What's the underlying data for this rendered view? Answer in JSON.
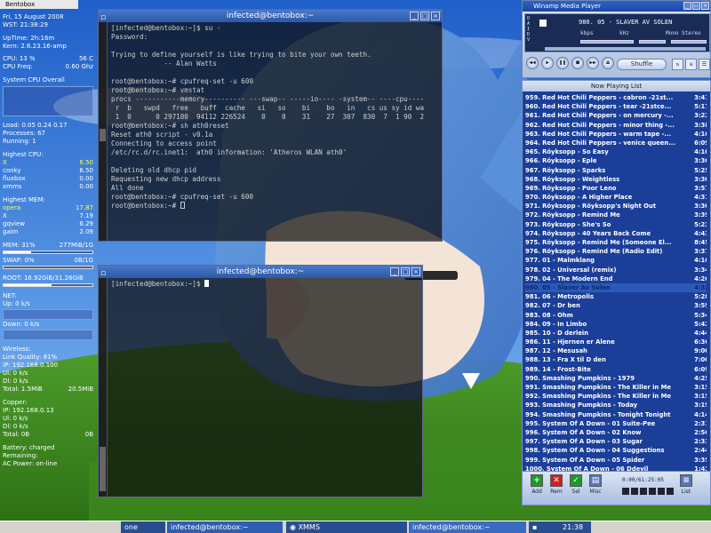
{
  "taskbar": {
    "desktop": "one",
    "task1": "infected@bentobox:~",
    "task2": "XMMS",
    "task3": "infected@bentobox:~",
    "clock": "21:38"
  },
  "conky": {
    "tab": "Bentobox",
    "date": "Fri, 15 August 2008",
    "wst": "WST: 21:38:29",
    "uptime": "UpTime: 2h:16m",
    "kern": "Kern: 2.6.23.16-amp",
    "cpu": "CPU: 13 %",
    "cpu_temp": "56 C",
    "cpu_freq_label": "CPU Freq:",
    "cpu_freq": "0.60 Ghz",
    "sys_cpu": "System CPU Overall",
    "load": "Load: 0.05 0.24 0.17",
    "processes": "Processes: 67",
    "running": "Running: 1",
    "highest_cpu": "Highest CPU:",
    "cpu_procs": [
      {
        "name": "X",
        "val": "6.50"
      },
      {
        "name": "conky",
        "val": "6.50"
      },
      {
        "name": "fluxbox",
        "val": "0.00"
      },
      {
        "name": "xmms",
        "val": "0.00"
      }
    ],
    "highest_mem": "Highest MEM:",
    "mem_procs": [
      {
        "name": "opera",
        "val": "17.87"
      },
      {
        "name": "X",
        "val": "7.19"
      },
      {
        "name": "gqview",
        "val": "6.29"
      },
      {
        "name": "gaim",
        "val": "2.09"
      }
    ],
    "mem": "MEM: 31%",
    "mem_val": "277MiB/1G",
    "swap": "SWAP: 0%",
    "swap_val": "0B/1G",
    "root": "ROOT: 16.92GiB/31.26GiB",
    "net": "NET:",
    "up": "Up: 0 k/s",
    "down": "Down: 0 k/s",
    "wireless": "Wireless:",
    "link_quality": "Link Quality: 81%",
    "ip1": "IP: 192.168.0.100",
    "ul1": "Ul: 0 k/s",
    "dl1": "Dl: 0 k/s",
    "total1": "Total: 1.5MiB",
    "total1b": "20.5MiB",
    "copper": "Copper:",
    "ip2": "IP: 192.168.0.13",
    "ul2": "Ul: 0 k/s",
    "dl2": "Dl: 0 k/s",
    "total2": "Total: 0B",
    "total2b": "0B",
    "battery": "Battery: charged",
    "remaining": "Remaining:",
    "ac": "AC Power: on-line"
  },
  "term1": {
    "title": "infected@bentobox:~",
    "lines": [
      "[infected@bentobox:~]$ su -",
      "Password:",
      "",
      "Trying to define yourself is like trying to bite your own teeth.",
      "             -- Alan Watts",
      "",
      "root@bentobox:~# cpufreq-set -u 600",
      "root@bentobox:~# vmstat",
      "procs -----------memory---------- ---swap-- -----io---- -system-- ----cpu----",
      " r  b   swpd   free   buff  cache   si   so    bi    bo   in   cs us sy id wa",
      " 1  0      0 297180  94112 226524    0    0    31    27  307  830  7  1 90  2",
      "root@bentobox:~# sh ath0reset",
      "Reset ath0 script - v0.1a",
      "Connecting to access point",
      "/etc/rc.d/rc.inet1:  ath0 information: 'Atheros WLAN ath0'",
      "",
      "Deleting old dhcp pid",
      "Requesting new dhcp address",
      "All done",
      "root@bentobox:~# cpufreq-set -u 600",
      "root@bentobox:~# "
    ]
  },
  "term2": {
    "title": "infected@bentobox:~",
    "prompt": "[infected@bentobox:~]$ "
  },
  "winamp": {
    "title": "Winamp Media Player",
    "side": "O\nA\nI\nD\nV",
    "track": "980. 05 - SLAVER AV SOLEN",
    "kbps": "kbps",
    "khz": "kHz",
    "mono": "Mono  Stereo",
    "shuffle": "Shuffle",
    "controls": [
      "◀◀",
      "▶",
      "❚❚",
      "■",
      "▶▶",
      "⏏"
    ]
  },
  "playlist": {
    "title": "Now Playing List",
    "time": "0:00/61:25:05",
    "buttons": [
      {
        "label": "Add",
        "icon": "+",
        "color": "#1a9a2a"
      },
      {
        "label": "Rem",
        "icon": "✕",
        "color": "#cc2222"
      },
      {
        "label": "Sel",
        "icon": "✓",
        "color": "#1a9a2a"
      },
      {
        "label": "Misc",
        "icon": "▤",
        "color": "#5577bb"
      },
      {
        "label": "List",
        "icon": "≡",
        "color": "#5577bb"
      }
    ],
    "items": [
      {
        "t": "959. Red Hot Chili Peppers - cabron -21st...",
        "d": "3:41"
      },
      {
        "t": "960. Red Hot Chili Peppers - tear -21stce...",
        "d": "5:17"
      },
      {
        "t": "961. Red Hot Chili Peppers - on mercury -...",
        "d": "3:22"
      },
      {
        "t": "962. Red Hot Chili Peppers - minor thing -...",
        "d": "3:38"
      },
      {
        "t": "963. Red Hot Chili Peppers - warm tape -...",
        "d": "4:16"
      },
      {
        "t": "964. Red Hot Chili Peppers - venice queen...",
        "d": "6:09"
      },
      {
        "t": "965. Röyksopp - So Easy",
        "d": "4:10"
      },
      {
        "t": "966. Röyksopp - Eple",
        "d": "3:36"
      },
      {
        "t": "967. Röyksopp - Sparks",
        "d": "5:25"
      },
      {
        "t": "968. Röyksopp - Weightless",
        "d": "3:30"
      },
      {
        "t": "969. Röyksopp - Poor Leno",
        "d": "3:57"
      },
      {
        "t": "970. Röyksopp - A Higher Place",
        "d": "4:31"
      },
      {
        "t": "971. Röyksopp - Röyksopp's Night Out",
        "d": "3:30"
      },
      {
        "t": "972. Röyksopp - Remind Me",
        "d": "3:39"
      },
      {
        "t": "973. Röyksopp - She's So",
        "d": "5:23"
      },
      {
        "t": "974. Röyksopp - 40 Years Back Come",
        "d": "4:43"
      },
      {
        "t": "975. Röyksopp - Remind Me (Someone El...",
        "d": "8:45"
      },
      {
        "t": "976. Röyksopp - Remind Me (Radio Edit)",
        "d": "3:37"
      },
      {
        "t": "977. 01 - Malmklang",
        "d": "4:16"
      },
      {
        "t": "978. 02 - Universal (remix)",
        "d": "3:34"
      },
      {
        "t": "979. 04 - The Modern End",
        "d": "4:26"
      },
      {
        "t": "980. 05 - Slaver Av Solen",
        "d": "4:32",
        "cur": true
      },
      {
        "t": "981. 06 - Metropolis",
        "d": "5:28"
      },
      {
        "t": "982. 07 - Dr ben",
        "d": "3:59"
      },
      {
        "t": "983. 08 - Ohm",
        "d": "5:34"
      },
      {
        "t": "984. 09 - In Limbo",
        "d": "5:42"
      },
      {
        "t": "985. 10 - D derlein",
        "d": "4:44"
      },
      {
        "t": "986. 11 - Hjernen er Alene",
        "d": "6:36"
      },
      {
        "t": "987. 12 - Mesusah",
        "d": "9:00"
      },
      {
        "t": "988. 13 - Fra X til D den",
        "d": "7:00"
      },
      {
        "t": "989. 14 - Frost-Bite",
        "d": "6:09"
      },
      {
        "t": "990. Smashing Pumpkins - 1979",
        "d": "4:25"
      },
      {
        "t": "991. Smashing Pumpkins - The Killer in Me",
        "d": "3:15"
      },
      {
        "t": "992. Smashing Pumpkins - The Killer in Me",
        "d": "3:15"
      },
      {
        "t": "993. Smashing Pumpkins - Today",
        "d": "3:19"
      },
      {
        "t": "994. Smashing Pumpkins - Tonight Tonight",
        "d": "4:14"
      },
      {
        "t": "995. System Of A Down - 01 Suite-Pee",
        "d": "2:31"
      },
      {
        "t": "996. System Of A Down - 02 Know",
        "d": "2:56"
      },
      {
        "t": "997. System Of A Down - 03 Sugar",
        "d": "2:33"
      },
      {
        "t": "998. System Of A Down - 04 Suggestions",
        "d": "2:44"
      },
      {
        "t": "999. System Of A Down - 05 Spider",
        "d": "3:35"
      },
      {
        "t": "1000. System Of A Down - 06 Ddevil",
        "d": "1:43"
      }
    ]
  }
}
